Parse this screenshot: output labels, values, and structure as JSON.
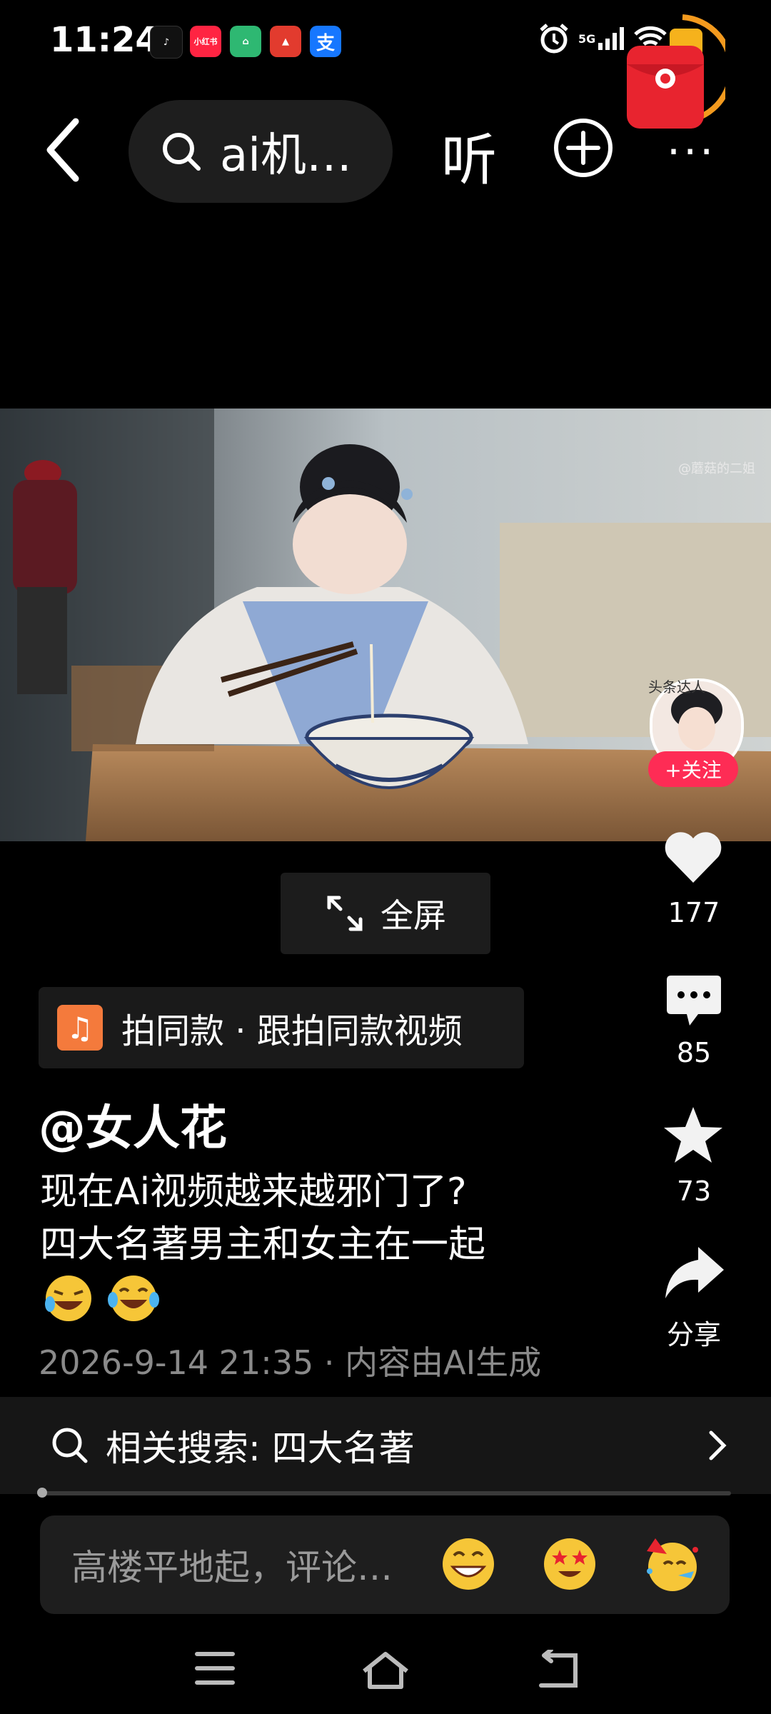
{
  "status_bar": {
    "time": "11:24",
    "apps": [
      {
        "name": "douyin-app-icon",
        "label": "♪",
        "color": "#111111"
      },
      {
        "name": "xiaohongshu-app-icon",
        "label": "小红书",
        "color": "#ff2442"
      },
      {
        "name": "housing-app-icon",
        "label": "⌂",
        "color": "#2eb872"
      },
      {
        "name": "bank-app-icon",
        "label": "▲",
        "color": "#e23b2e"
      },
      {
        "name": "alipay-app-icon",
        "label": "支",
        "color": "#1677ff"
      }
    ],
    "network": "5G"
  },
  "top_bar": {
    "search_text": "ai机…",
    "listen_label": "听",
    "more_label": "···"
  },
  "video": {
    "watermark": "@蘑菇的二姐"
  },
  "creator": {
    "badge": "头条达人",
    "follow_label": "+关注"
  },
  "actions": {
    "likes": "177",
    "comments": "85",
    "favorites": "73",
    "share_label": "分享"
  },
  "fullscreen_label": "全屏",
  "music": {
    "text": "拍同款 · 跟拍同款视频"
  },
  "post": {
    "author": "@女人花",
    "desc_line1": "现在Ai视频越来越邪门了?",
    "desc_line2": "四大名著男主和女主在一起",
    "date": "2026-9-14 21:35",
    "ai_note": "内容由AI生成"
  },
  "related_search": {
    "label": "相关搜索: 四大名著"
  },
  "progress": 0.0,
  "comment": {
    "placeholder": "高楼平地起，评论…"
  },
  "colors": {
    "accent_follow": "#fe2c55",
    "background": "#000000"
  }
}
